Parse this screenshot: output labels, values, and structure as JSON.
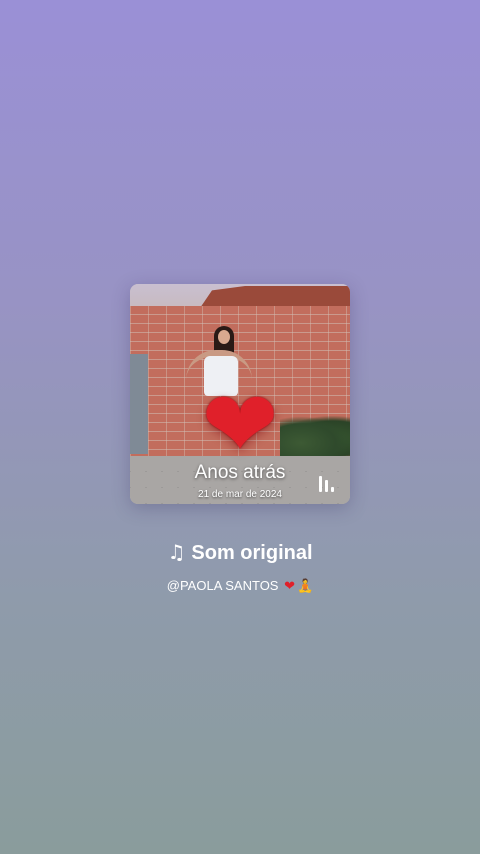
{
  "colors": {
    "background_top": "#9a90d6",
    "background_bottom": "#8a9c9c",
    "text": "#ffffff",
    "heart": "#e0202a"
  },
  "card": {
    "overlay_title": "Anos atrás",
    "overlay_date": "21 de mar de 2024",
    "heart_icon": "heart-emoji",
    "equalizer_icon": "equalizer-icon"
  },
  "sound": {
    "note_icon": "♫",
    "title": "Som original",
    "author": "@PAOLA SANTOS",
    "author_emoji_heart": "❤",
    "author_emoji_person": "🧘"
  }
}
